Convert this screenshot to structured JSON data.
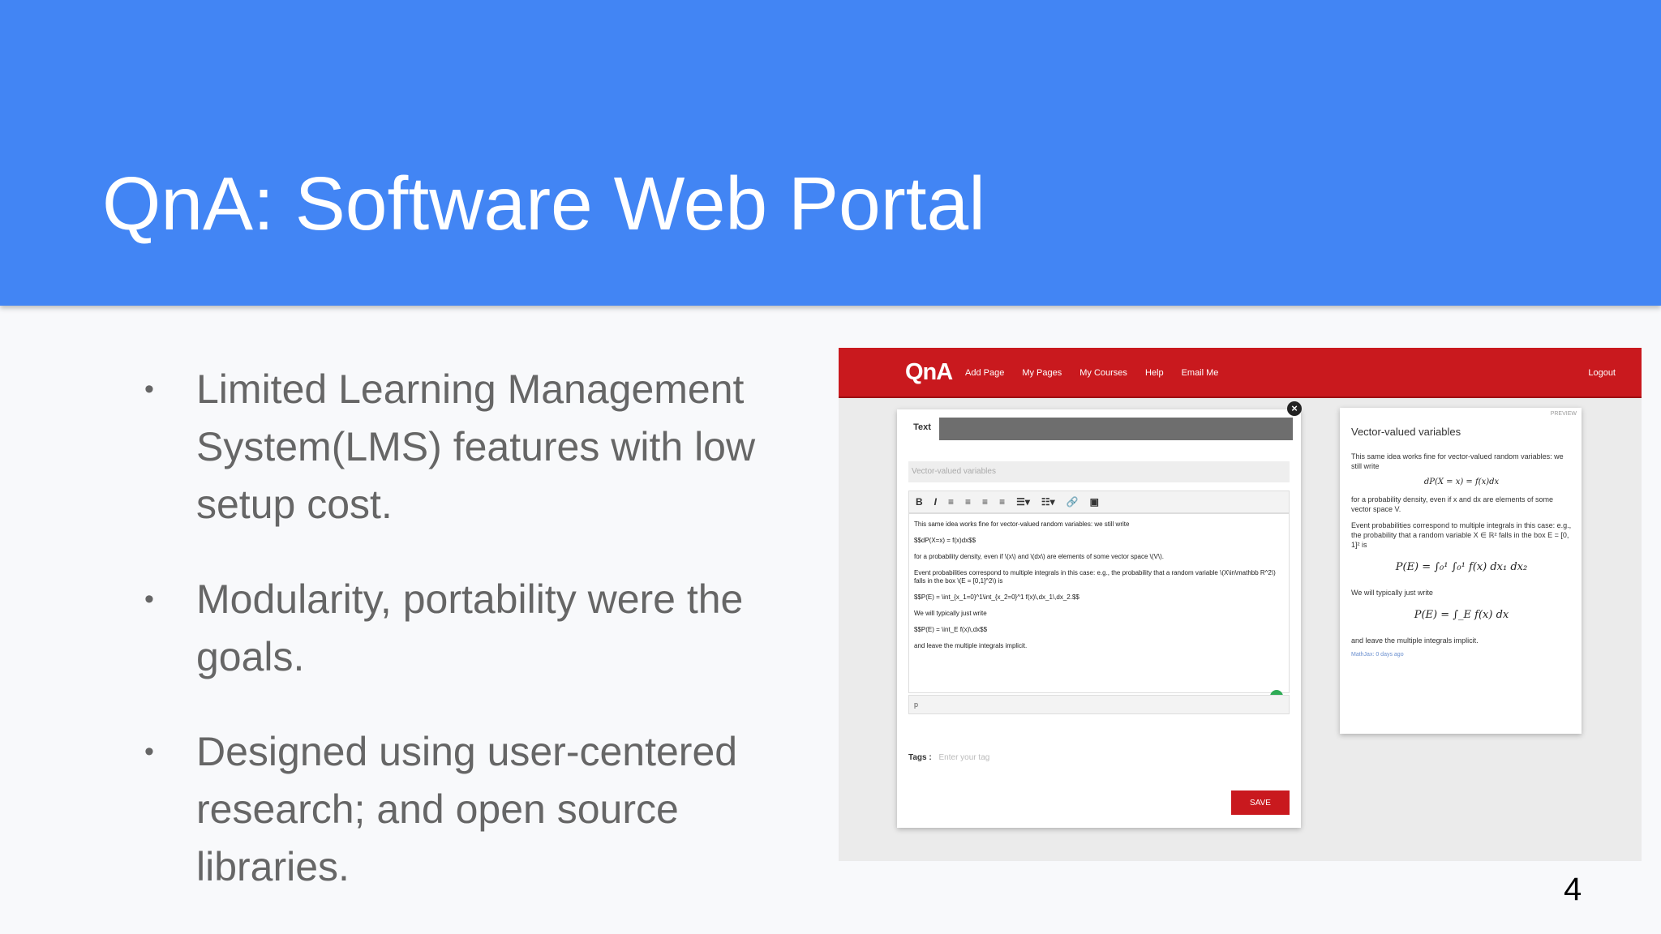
{
  "slide": {
    "title": "QnA: Software Web Portal",
    "bullets": [
      "Limited Learning Management System(LMS) features with low setup cost.",
      "Modularity, portability were the goals.",
      "Designed using user-centered research; and open source libraries."
    ],
    "page_number": "4",
    "bullet_glyph": "•"
  },
  "app": {
    "brand": "QnA",
    "nav": [
      "Add Page",
      "My Pages",
      "My Courses",
      "Help",
      "Email Me"
    ],
    "logout": "Logout",
    "editor": {
      "tab": "Text",
      "close": "×",
      "title_placeholder": "Vector-valued variables",
      "toolbar": [
        "B",
        "I",
        "≡",
        "≡",
        "≡",
        "≡",
        "☰▾",
        "☷▾",
        "🔗",
        "▣"
      ],
      "lines": [
        "This same idea works fine for vector-valued random variables: we still write",
        "$$dP(X=x) = f(x)dx$$",
        "for a probability density, even if \\(x\\) and \\(dx\\) are elements of some vector space \\(V\\).",
        "Event probabilities correspond to multiple integrals in this case: e.g., the probability that a random variable \\(X\\in\\mathbb R^2\\) falls in the box \\(E = [0,1]^2\\) is",
        "$$P(E) = \\int_{x_1=0}^1\\int_{x_2=0}^1 f(x)\\,dx_1\\,dx_2.$$",
        "We will typically just write",
        "$$P(E) = \\int_E f(x)\\,dx$$",
        "and leave the multiple integrals implicit."
      ],
      "status": "p",
      "tags_label": "Tags :",
      "tags_placeholder": "Enter your tag",
      "save": "SAVE"
    },
    "preview": {
      "label": "PREVIEW",
      "title": "Vector-valued variables",
      "p1": "This same idea works fine for vector-valued random variables: we still write",
      "eq1": "dP(X = x) = f(x)dx",
      "p2": "for a probability density, even if x and dx are elements of some vector space V.",
      "p3": "Event probabilities correspond to multiple integrals in this case: e.g., the probability that a random variable X ∈ ℝ² falls in the box E = [0, 1]² is",
      "eq2": "P(E) = ∫₀¹ ∫₀¹ f(x) dx₁ dx₂",
      "p4": "We will typically just write",
      "eq3": "P(E) = ∫_E f(x) dx",
      "p5": "and leave the multiple integrals implicit.",
      "footer": "MathJax: 0 days ago"
    }
  }
}
